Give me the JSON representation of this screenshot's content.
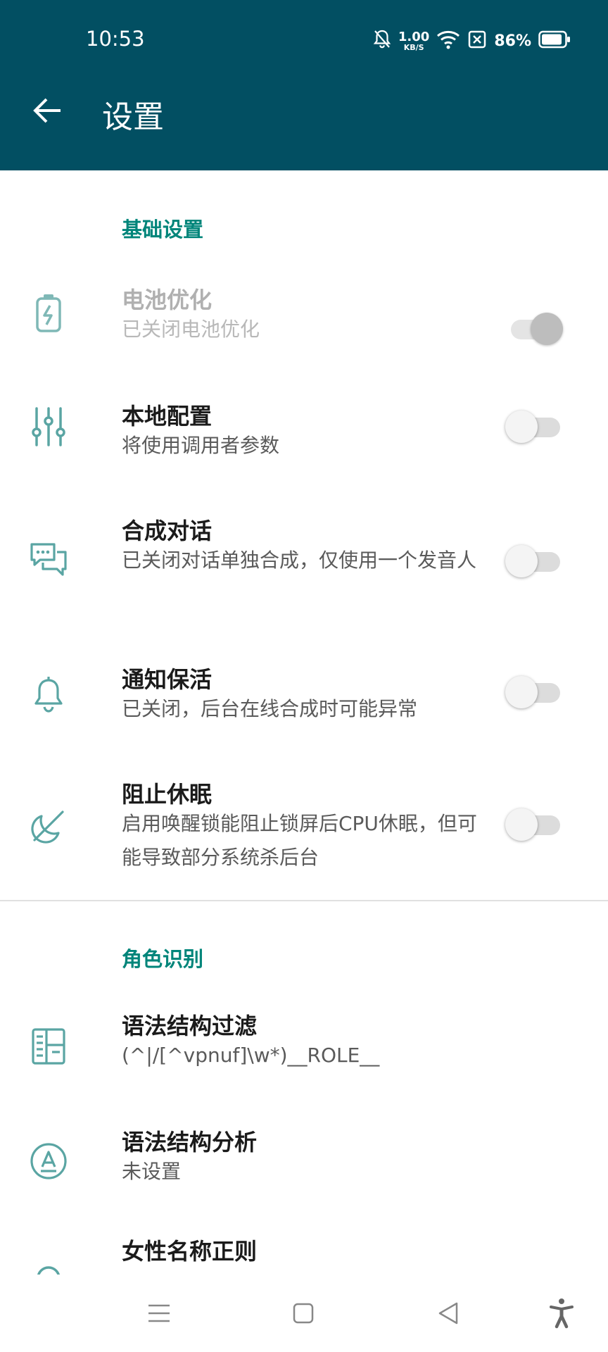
{
  "status_bar": {
    "time": "10:53",
    "net_speed_value": "1.00",
    "net_speed_unit": "KB/S",
    "battery_percent": "86%",
    "icons": [
      "bell-muted-icon",
      "wifi-icon",
      "sim-off-icon",
      "battery-icon"
    ]
  },
  "app_bar": {
    "title": "设置",
    "back_icon": "arrow-left-icon",
    "background_color": "#024f62"
  },
  "accent_color": "#00857a",
  "sections": [
    {
      "header": "基础设置",
      "items": [
        {
          "icon": "battery-charging-icon",
          "title": "电池优化",
          "subtitle": "已关闭电池优化",
          "toggle": true,
          "enabled": false
        },
        {
          "icon": "sliders-icon",
          "title": "本地配置",
          "subtitle": "将使用调用者参数",
          "toggle": false,
          "enabled": true
        },
        {
          "icon": "chat-bubbles-icon",
          "title": "合成对话",
          "subtitle": "已关闭对话单独合成，仅使用一个发音人",
          "toggle": false,
          "enabled": true
        },
        {
          "icon": "bell-icon",
          "title": "通知保活",
          "subtitle": "已关闭，后台在线合成时可能异常",
          "toggle": false,
          "enabled": true
        },
        {
          "icon": "sleep-off-icon",
          "title": "阻止休眠",
          "subtitle": "启用唤醒锁能阻止锁屏后CPU休眠，但可能导致部分系统杀后台",
          "toggle": false,
          "enabled": true
        }
      ]
    },
    {
      "header": "角色识别",
      "items": [
        {
          "icon": "list-structure-icon",
          "title": "语法结构过滤",
          "subtitle": "(^|/[^vpnuf]\\w*)__ROLE__"
        },
        {
          "icon": "text-analysis-icon",
          "title": "语法结构分析",
          "subtitle": "未设置"
        },
        {
          "icon": "female-icon",
          "title": "女性名称正则",
          "subtitle": ""
        }
      ]
    }
  ],
  "nav_bar": [
    "menu-icon",
    "home-square-icon",
    "back-triangle-icon",
    "accessibility-icon"
  ]
}
